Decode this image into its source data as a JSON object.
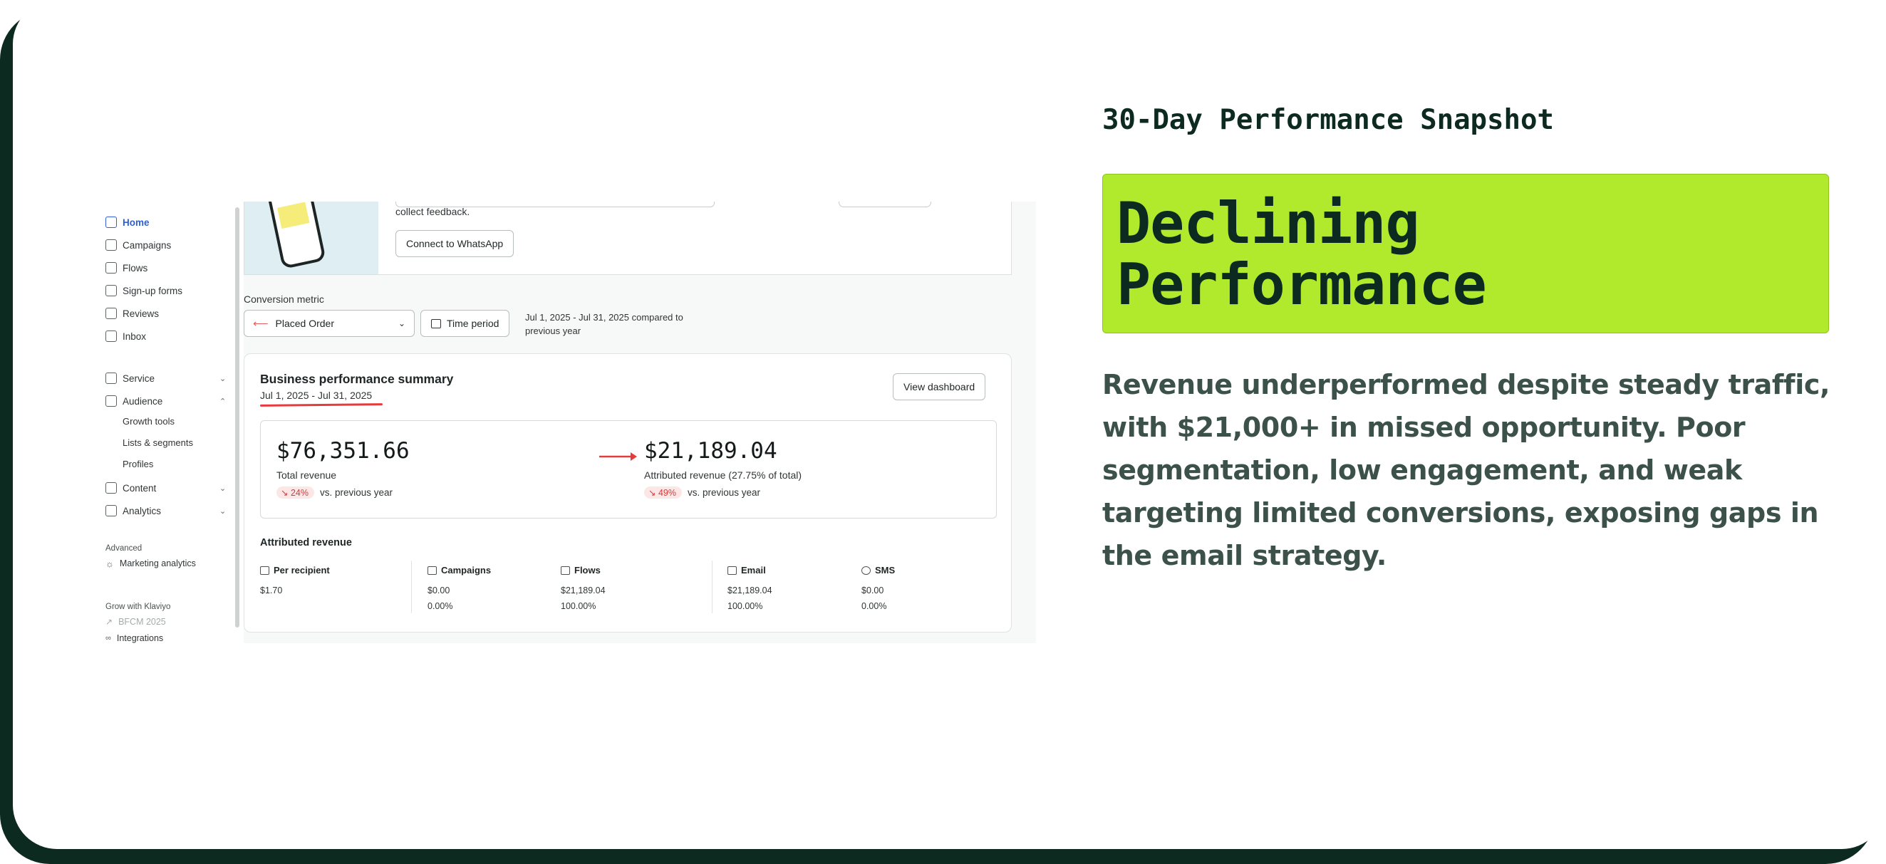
{
  "panel": {
    "kicker": "30-Day Performance Snapshot",
    "title_line1": "Declining",
    "title_line2": "Performance",
    "description": "Revenue underperformed despite steady traffic, with $21,000+ in missed opportunity. Poor segmentation, low engagement, and weak targeting limited conversions, exposing gaps in the email strategy."
  },
  "sidebar": {
    "items": [
      {
        "label": "Home",
        "icon": "home-icon",
        "active": true
      },
      {
        "label": "Campaigns",
        "icon": "send-icon"
      },
      {
        "label": "Flows",
        "icon": "flow-icon"
      },
      {
        "label": "Sign-up forms",
        "icon": "form-icon"
      },
      {
        "label": "Reviews",
        "icon": "star-icon"
      },
      {
        "label": "Inbox",
        "icon": "inbox-icon"
      }
    ],
    "groups": [
      {
        "label": "Service",
        "icon": "inbox-icon",
        "chevron": "chevron-down-icon"
      },
      {
        "label": "Audience",
        "icon": "people-icon",
        "chevron": "chevron-up-icon"
      },
      {
        "label": "Content",
        "icon": "content-icon",
        "chevron": "chevron-down-icon"
      },
      {
        "label": "Analytics",
        "icon": "chart-icon",
        "chevron": "chevron-down-icon"
      }
    ],
    "audience_sub": [
      "Growth tools",
      "Lists & segments",
      "Profiles"
    ],
    "advanced_label": "Advanced",
    "marketing_analytics": "Marketing analytics",
    "grow_label": "Grow with Klaviyo",
    "bfcm": "BFCM 2025",
    "integrations": "Integrations"
  },
  "banner": {
    "text": "collect feedback.",
    "button": "Connect to WhatsApp"
  },
  "filters": {
    "conversion_label": "Conversion metric",
    "metric_value": "Placed Order",
    "time_button": "Time period",
    "period_note": "Jul 1, 2025 - Jul 31, 2025 compared to previous year"
  },
  "summary": {
    "title": "Business performance summary",
    "date": "Jul 1, 2025 - Jul 31, 2025",
    "view_button": "View dashboard",
    "total_revenue": "$76,351.66",
    "total_label": "Total revenue",
    "total_change": "24%",
    "attributed_revenue": "$21,189.04",
    "attributed_label": "Attributed revenue (27.75% of total)",
    "attributed_change": "49%",
    "vs_label": "vs. previous year",
    "accent_red": "#e63b3b",
    "attributed_title": "Attributed revenue",
    "columns": [
      {
        "label": "Per recipient",
        "icon": "people-icon",
        "value": "$1.70",
        "pct": ""
      },
      {
        "label": "Campaigns",
        "icon": "send-icon",
        "value": "$0.00",
        "pct": "0.00%"
      },
      {
        "label": "Flows",
        "icon": "flow-icon",
        "value": "$21,189.04",
        "pct": "100.00%"
      },
      {
        "label": "Email",
        "icon": "mail-icon",
        "value": "$21,189.04",
        "pct": "100.00%"
      },
      {
        "label": "SMS",
        "icon": "sms-icon",
        "value": "$0.00",
        "pct": "0.00%"
      }
    ]
  },
  "colors": {
    "hero_bg": "#b1e92c",
    "dark_green": "#0d2a21",
    "body_text": "#3b514a",
    "link_blue": "#2f5fd0"
  }
}
